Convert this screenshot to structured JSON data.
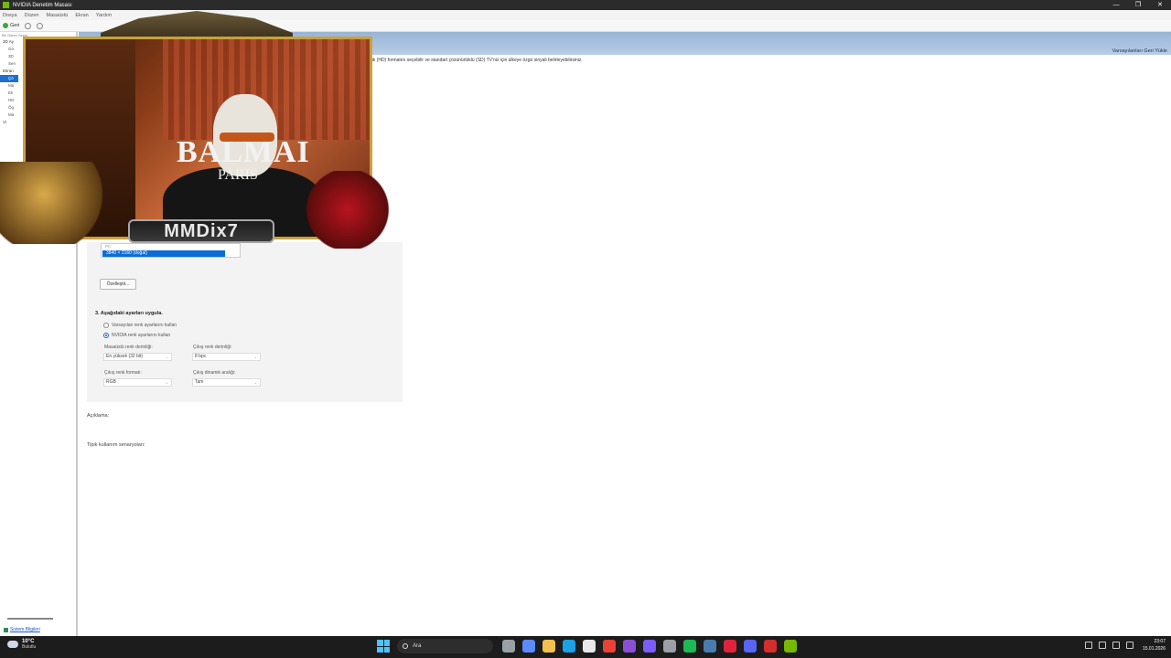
{
  "window": {
    "title": "NVIDIA Denetim Masası",
    "controls": [
      "—",
      "❐",
      "✕"
    ]
  },
  "menu": [
    "Dosya",
    "Düzen",
    "Masaüstü",
    "Ekran",
    "Yardım"
  ],
  "toolbar": {
    "back_label": "Geri"
  },
  "tree": {
    "hint": "Bir Görev Seçin",
    "nodes": [
      {
        "label": "3D Ay",
        "top": true
      },
      {
        "label": "Gö",
        "top": false
      },
      {
        "label": "3D",
        "top": false
      },
      {
        "label": "Sen",
        "top": false
      },
      {
        "label": "Ekran",
        "top": true
      },
      {
        "label": "Çö",
        "top": false,
        "selected": true
      },
      {
        "label": "Ma",
        "top": false
      },
      {
        "label": "Ek",
        "top": false
      },
      {
        "label": "HD",
        "top": false
      },
      {
        "label": "Ög",
        "top": false
      },
      {
        "label": "Ma",
        "top": false
      },
      {
        "label": "Vi",
        "top": true
      }
    ],
    "system_info": "Sistem Bilgileri"
  },
  "content": {
    "restore_defaults": "Varsayılanları Geri Yükle",
    "description_line": "ük (HD) formatını seçebilir ve standart çözünürlüklü (SD) TV'niz için ülkeye özgü sinyali belirleyebilirsiniz.",
    "resolution_partial": "PC",
    "resolution_selected": "3840 × 2160 (doğal)",
    "customize_button": "Özelleştir...",
    "step3_title": "3. Aşağıdaki ayarları uygula.",
    "radio_default": "Varsayılan renk ayarlarını kullan",
    "radio_nvidia": "NVIDIA renk ayarlarını kullan",
    "desktop_depth_label": "Masaüstü renk derinliği:",
    "desktop_depth_value": "En yüksek (32 bit)",
    "output_depth_label": "Çıkış renk derinliği:",
    "output_depth_value": "8 bpc",
    "output_format_label": "Çıkış renk formatı:",
    "output_format_value": "RGB",
    "dynamic_range_label": "Çıkış dinamik aralığı:",
    "dynamic_range_value": "Tam",
    "explanation_label": "Açıklama:",
    "typical_label": "Tipik kullanım senaryoları:"
  },
  "overlay": {
    "shirt_text": "BALMAI",
    "shirt_sub": "PARIS",
    "streamer_name": "MMDix7"
  },
  "taskbar": {
    "temp": "10°C",
    "condition": "Bulutlu",
    "search_placeholder": "Ara",
    "time": "23:07",
    "date": "15.01.2026",
    "apps": [
      {
        "name": "task-view-icon",
        "color": "#9aa0a6"
      },
      {
        "name": "copilot-icon",
        "color": "#5a8cff"
      },
      {
        "name": "file-explorer-icon",
        "color": "#f2c14e"
      },
      {
        "name": "edge-icon",
        "color": "#1aa1e6"
      },
      {
        "name": "store-icon",
        "color": "#e8e8e8"
      },
      {
        "name": "chrome-icon",
        "color": "#e94235"
      },
      {
        "name": "colorful-app-icon",
        "color": "#8a4fd6"
      },
      {
        "name": "grid-app-icon",
        "color": "#7b5cff"
      },
      {
        "name": "settings-icon",
        "color": "#9aa0a6"
      },
      {
        "name": "spotify-icon",
        "color": "#1db954"
      },
      {
        "name": "steam-icon",
        "color": "#4a7bb0"
      },
      {
        "name": "opera-icon",
        "color": "#e0233b"
      },
      {
        "name": "discord-icon",
        "color": "#5865f2"
      },
      {
        "name": "red-app-icon",
        "color": "#d22e2e"
      },
      {
        "name": "nvidia-icon",
        "color": "#76b900"
      }
    ]
  }
}
